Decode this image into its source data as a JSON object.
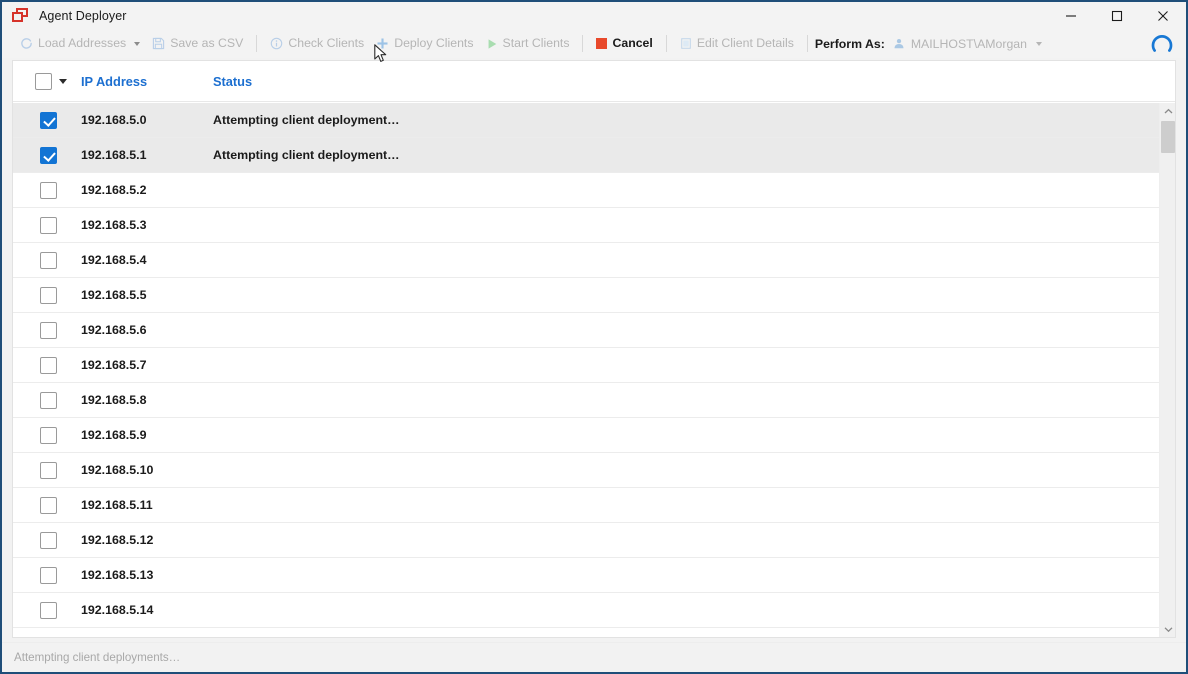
{
  "window": {
    "title": "Agent Deployer",
    "icon": "app-window-icon",
    "border_color": "#1f4e79",
    "controls": [
      {
        "name": "minimize",
        "glyph": "minimize-icon"
      },
      {
        "name": "maximize",
        "glyph": "maximize-icon"
      },
      {
        "name": "close",
        "glyph": "close-icon"
      }
    ]
  },
  "toolbar": {
    "items": [
      {
        "label": "Load Addresses",
        "icon": "refresh-icon",
        "enabled": false,
        "has_caret": true
      },
      {
        "label": "Save as CSV",
        "icon": "floppy-disk-icon",
        "enabled": false,
        "has_caret": false
      },
      {
        "label": "Check Clients",
        "icon": "info-circle-icon",
        "enabled": false,
        "has_caret": false
      },
      {
        "label": "Deploy Clients",
        "icon": "plus-icon",
        "enabled": false,
        "has_caret": false
      },
      {
        "label": "Start Clients",
        "icon": "play-icon",
        "enabled": false,
        "has_caret": false
      },
      {
        "label": "Cancel",
        "icon": "stop-square-icon",
        "enabled": true,
        "has_caret": false
      },
      {
        "label": "Edit Client Details",
        "icon": "document-icon",
        "enabled": false,
        "has_caret": false
      }
    ],
    "perform_as_label": "Perform As:",
    "perform_as_user": "MAILHOST\\AMorgan",
    "perform_as_icon": "user-icon",
    "busy_indicator": "loading-spinner-icon",
    "accent_color": "#1c6fd0",
    "cancel_icon_color": "#e8492b",
    "disabled_color": "#b5b5b5"
  },
  "list": {
    "columns": [
      "IP Address",
      "Status"
    ],
    "header_select_all_checked": false,
    "rows": [
      {
        "checked": true,
        "ip": "192.168.5.0",
        "status": "Attempting client deployment…",
        "selected": true
      },
      {
        "checked": true,
        "ip": "192.168.5.1",
        "status": "Attempting client deployment…",
        "selected": true
      },
      {
        "checked": false,
        "ip": "192.168.5.2",
        "status": "",
        "selected": false
      },
      {
        "checked": false,
        "ip": "192.168.5.3",
        "status": "",
        "selected": false
      },
      {
        "checked": false,
        "ip": "192.168.5.4",
        "status": "",
        "selected": false
      },
      {
        "checked": false,
        "ip": "192.168.5.5",
        "status": "",
        "selected": false
      },
      {
        "checked": false,
        "ip": "192.168.5.6",
        "status": "",
        "selected": false
      },
      {
        "checked": false,
        "ip": "192.168.5.7",
        "status": "",
        "selected": false
      },
      {
        "checked": false,
        "ip": "192.168.5.8",
        "status": "",
        "selected": false
      },
      {
        "checked": false,
        "ip": "192.168.5.9",
        "status": "",
        "selected": false
      },
      {
        "checked": false,
        "ip": "192.168.5.10",
        "status": "",
        "selected": false
      },
      {
        "checked": false,
        "ip": "192.168.5.11",
        "status": "",
        "selected": false
      },
      {
        "checked": false,
        "ip": "192.168.5.12",
        "status": "",
        "selected": false
      },
      {
        "checked": false,
        "ip": "192.168.5.13",
        "status": "",
        "selected": false
      },
      {
        "checked": false,
        "ip": "192.168.5.14",
        "status": "",
        "selected": false
      },
      {
        "checked": false,
        "ip": "",
        "status": "",
        "selected": false
      }
    ]
  },
  "scrollbar": {
    "up_arrow": "chevron-up-icon",
    "down_arrow": "chevron-down-icon"
  },
  "statusbar": {
    "text": "Attempting client deployments…"
  }
}
